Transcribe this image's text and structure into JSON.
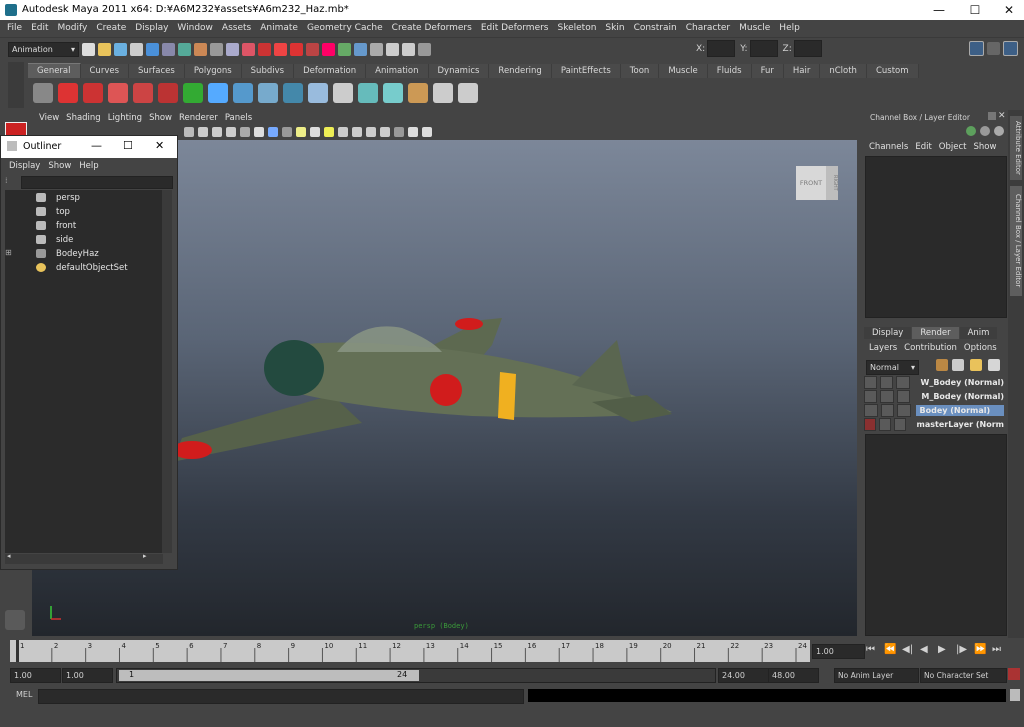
{
  "window": {
    "title": "Autodesk Maya 2011 x64: D:¥A6M232¥assets¥A6m232_Haz.mb*",
    "minimize": "—",
    "maximize": "☐",
    "close": "✕"
  },
  "menubar": [
    "File",
    "Edit",
    "Modify",
    "Create",
    "Display",
    "Window",
    "Assets",
    "Animate",
    "Geometry Cache",
    "Create Deformers",
    "Edit Deformers",
    "Skeleton",
    "Skin",
    "Constrain",
    "Character",
    "Muscle",
    "Help"
  ],
  "statusline": {
    "menuset": "Animation",
    "x_label": "X:",
    "y_label": "Y:",
    "z_label": "Z:"
  },
  "shelf": {
    "tabs": [
      "General",
      "Curves",
      "Surfaces",
      "Polygons",
      "Subdivs",
      "Deformation",
      "Animation",
      "Dynamics",
      "Rendering",
      "PaintEffects",
      "Toon",
      "Muscle",
      "Fluids",
      "Fur",
      "Hair",
      "nCloth",
      "Custom"
    ],
    "active_tab": "General"
  },
  "panel": {
    "menu": [
      "View",
      "Shading",
      "Lighting",
      "Show",
      "Renderer",
      "Panels"
    ],
    "camera_label": "persp (Bodey)",
    "viewcube_front": "FRONT",
    "viewcube_right": "RIGHT"
  },
  "outliner": {
    "title": "Outliner",
    "menu": [
      "Display",
      "Show",
      "Help"
    ],
    "items": [
      {
        "label": "persp",
        "icon": "camera-icon"
      },
      {
        "label": "top",
        "icon": "camera-icon"
      },
      {
        "label": "front",
        "icon": "camera-icon"
      },
      {
        "label": "side",
        "icon": "camera-icon"
      },
      {
        "label": "BodeyHaz",
        "icon": "group-icon"
      },
      {
        "label": "defaultObjectSet",
        "icon": "set-icon"
      }
    ]
  },
  "channel_box": {
    "title": "Channel Box / Layer Editor",
    "menu": [
      "Channels",
      "Edit",
      "Object",
      "Show"
    ],
    "layer_tabs": [
      "Display",
      "Render",
      "Anim"
    ],
    "active_layer_tab": "Render",
    "layer_menu": [
      "Layers",
      "Contribution",
      "Options"
    ],
    "blend_mode": "Normal",
    "layers": [
      {
        "name": "W_Bodey (Normal)",
        "selected": false
      },
      {
        "name": "M_Bodey (Normal)",
        "selected": false
      },
      {
        "name": "Bodey (Normal)",
        "selected": true
      },
      {
        "name": "masterLayer (Norm",
        "selected": false
      }
    ],
    "side_tabs": [
      "Attribute Editor",
      "Channel Box / Layer Editor"
    ]
  },
  "timeline": {
    "ticks": [
      "1",
      "2",
      "3",
      "4",
      "5",
      "6",
      "7",
      "8",
      "9",
      "10",
      "11",
      "12",
      "13",
      "14",
      "15",
      "16",
      "17",
      "18",
      "19",
      "20",
      "21",
      "22",
      "23",
      "24"
    ],
    "current_frame": "1.00"
  },
  "range": {
    "start": "1.00",
    "start2": "1.00",
    "slider_start": "1",
    "slider_end": "24",
    "end": "24.00",
    "end2": "48.00",
    "anim_layer": "No Anim Layer",
    "char_set": "No Character Set"
  },
  "command": {
    "mel_label": "MEL"
  },
  "colors": {
    "accent": "#6a8fbf",
    "hinomaru": "#d11c1c",
    "band": "#f0b020",
    "fuselage": "#5e6a4e"
  }
}
